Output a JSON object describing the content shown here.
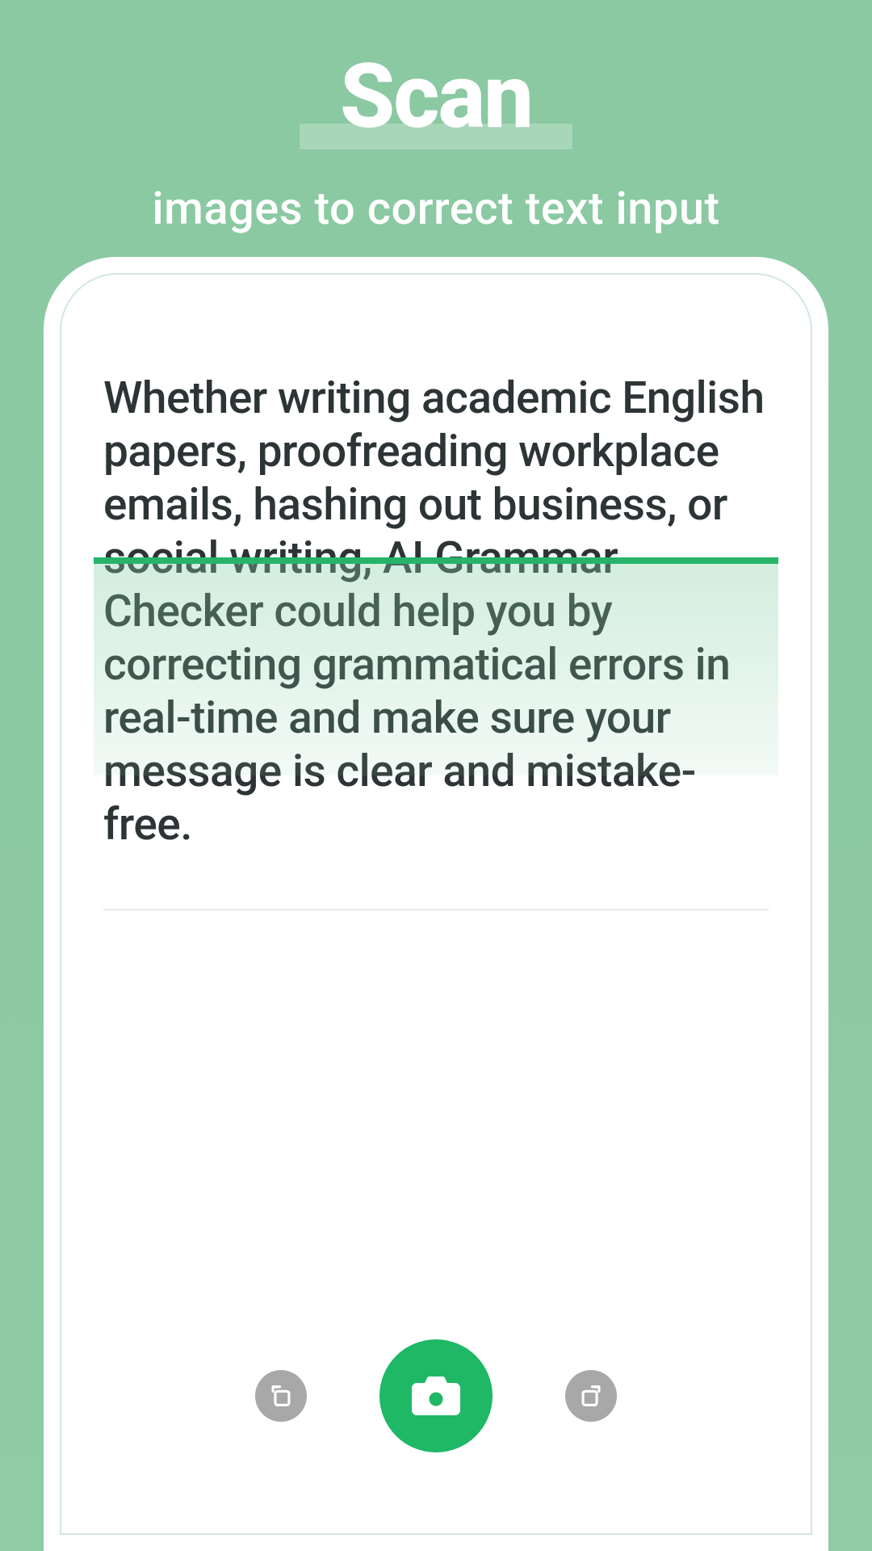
{
  "header": {
    "title": "Scan",
    "subtitle": "images to correct text input"
  },
  "content": {
    "body_text": "Whether writing academic English papers, proofreading workplace emails, hashing out business, or social writing, AI Grammar Checker could help you by correcting grammatical errors in real-time and make sure your message is clear and mistake-free."
  },
  "toolbar": {
    "rotate_left_icon": "rotate-left",
    "camera_icon": "camera",
    "rotate_right_icon": "rotate-right"
  },
  "colors": {
    "background_green": "#8ac9a2",
    "accent_green": "#1fb866",
    "scan_line": "#27b46a",
    "text_dark": "#2d3436",
    "btn_gray": "#a8a8a8"
  }
}
